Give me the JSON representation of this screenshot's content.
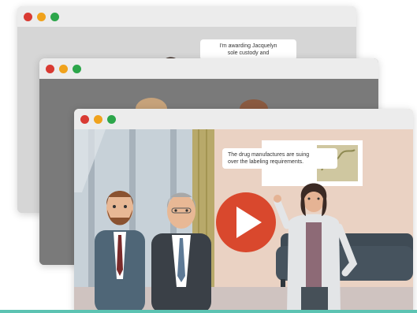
{
  "windows": [
    {
      "id": "back",
      "bubble_text_line1": "I'm awarding Jacquelyn",
      "bubble_text_line2": "sole custody and"
    },
    {
      "id": "middle"
    },
    {
      "id": "front",
      "bubble_text_line1": "The drug manufactures are suing",
      "bubble_text_line2": "over the labeling requirements."
    }
  ],
  "icons": {
    "play": "play-icon",
    "close": "close-dot",
    "minimize": "minimize-dot",
    "maximize": "maximize-dot"
  },
  "colors": {
    "play_button": "#d9482d",
    "accent_bar": "#5cc3b2",
    "sofa": "#3f4b55"
  }
}
